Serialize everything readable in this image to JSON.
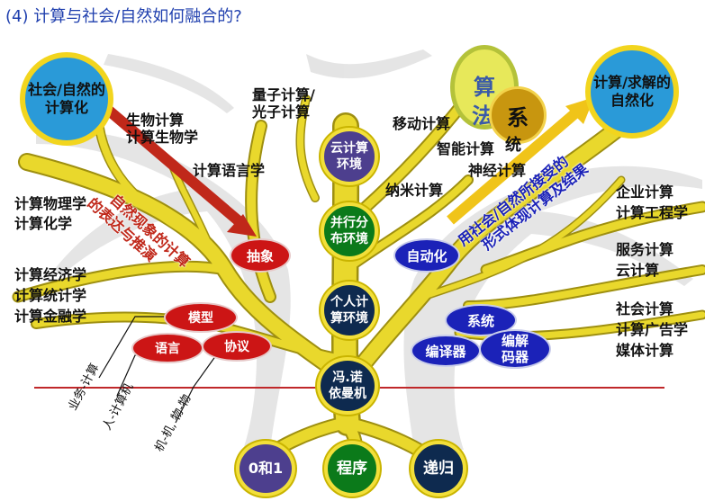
{
  "title": "(4) 计算与社会/自然如何融合的?",
  "corner_left": {
    "line1": "社会/自然",
    "line2": "的计算化"
  },
  "corner_right": {
    "line1": "计算/求解",
    "line2": "的自然化"
  },
  "left_arrow_label": {
    "line1": "自然现象的计算",
    "line2": "的表达与推演"
  },
  "right_arrow_label": {
    "line1": "用社会/自然所接受的",
    "line2": "形式体现计算及结果"
  },
  "top_circles": {
    "suan": "算",
    "fa": "法",
    "xi": "系",
    "tong": "统"
  },
  "trunk_nodes": {
    "cloud_env": {
      "line1": "云计算",
      "line2": "环境"
    },
    "parallel_env": {
      "line1": "并行分",
      "line2": "布环境"
    },
    "personal_env": {
      "line1": "个人计",
      "line2": "算环境"
    },
    "von_neumann": {
      "line1": "冯.诺",
      "line2": "依曼机"
    }
  },
  "ovals": {
    "abstraction": "抽象",
    "automation": "自动化",
    "model": "模型",
    "language": "语言",
    "protocol": "协议",
    "system": "系统",
    "compiler": "编译器",
    "codec": "编解码器"
  },
  "roots": {
    "binary": "0和1",
    "program": "程序",
    "recursion": "递归"
  },
  "branch_labels": {
    "quantum": {
      "line1": "量子计算/",
      "line2": "光子计算"
    },
    "bio": {
      "line1": "生物计算",
      "line2": "计算生物学"
    },
    "comp_linguistics": "计算语言学",
    "mobile": "移动计算",
    "smart": "智能计算",
    "neural": "神经计算",
    "nano": "纳米计算",
    "physics_chem": {
      "line1": "计算物理学",
      "line2": "计算化学"
    },
    "econ": {
      "line1": "计算经济学",
      "line2": "计算统计学",
      "line3": "计算金融学"
    },
    "enterprise": {
      "line1": "企业计算",
      "line2": "计算工程学"
    },
    "service": {
      "line1": "服务计算",
      "line2": "云计算"
    },
    "social": {
      "line1": "社会计算",
      "line2": "计算广告学",
      "line3": "媒体计算"
    }
  },
  "slanted_labels": {
    "business": "业务-计算",
    "human_machine": "人-计算机",
    "machine_object": "机-机, 物-物"
  },
  "colors": {
    "branch": "#e9d82c",
    "branch_edge": "#9e8f10",
    "red_arrow": "#c0281a",
    "yellow_arrow": "#f0c419",
    "baseline": "#c0282a",
    "title": "#1f3fae"
  }
}
